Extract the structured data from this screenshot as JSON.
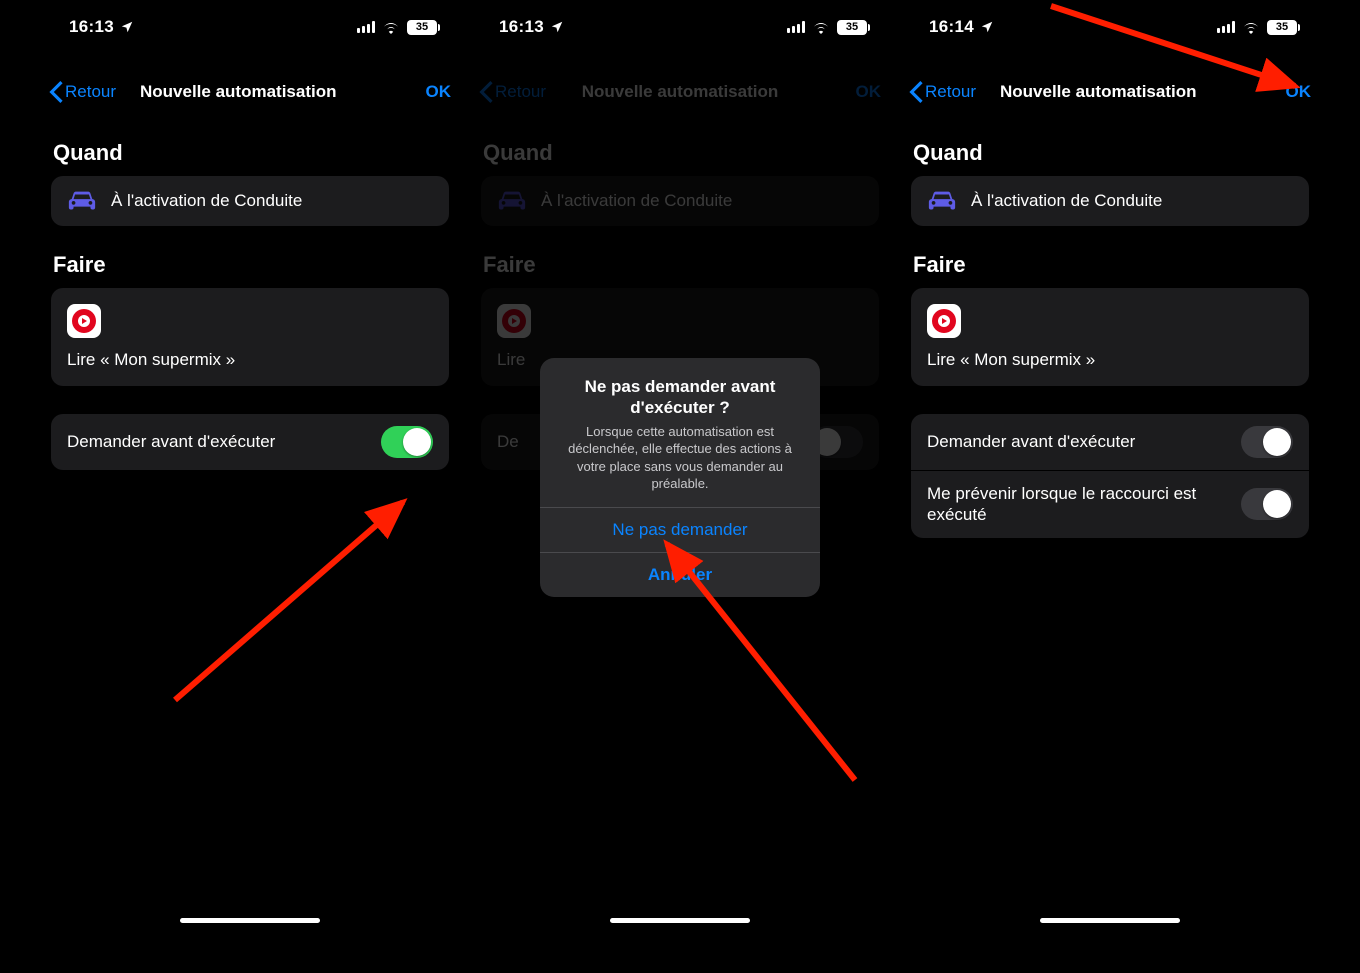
{
  "screens": {
    "s1": {
      "statusbar": {
        "time": "16:13",
        "battery": "35"
      },
      "nav": {
        "back": "Retour",
        "title": "Nouvelle automatisation",
        "done": "OK"
      },
      "sections": {
        "when_header": "Quand",
        "do_header": "Faire",
        "when_text": "À l'activation de Conduite",
        "action_text": "Lire « Mon supermix »"
      },
      "toggle1": {
        "label": "Demander avant d'exécuter",
        "on": true
      }
    },
    "s2": {
      "statusbar": {
        "time": "16:13",
        "battery": "35"
      },
      "nav": {
        "back": "Retour",
        "title": "Nouvelle automatisation",
        "done": "OK"
      },
      "sections": {
        "when_header": "Quand",
        "do_header": "Faire",
        "when_text": "À l'activation de Conduite",
        "action_text_cut": "Lire"
      },
      "toggle1": {
        "label_cut": "De"
      },
      "alert": {
        "title": "Ne pas demander avant d'exécuter ?",
        "message": "Lorsque cette automatisation est déclenchée, elle effectue des actions à votre place sans vous demander au préalable.",
        "confirm": "Ne pas demander",
        "cancel": "Annuler"
      }
    },
    "s3": {
      "statusbar": {
        "time": "16:14",
        "battery": "35"
      },
      "nav": {
        "back": "Retour",
        "title": "Nouvelle automatisation",
        "done": "OK"
      },
      "sections": {
        "when_header": "Quand",
        "do_header": "Faire",
        "when_text": "À l'activation de Conduite",
        "action_text": "Lire « Mon supermix »"
      },
      "toggle1": {
        "label": "Demander avant d'exécuter",
        "on": false
      },
      "toggle2": {
        "label": "Me prévenir lorsque le raccourci est exécuté",
        "on": false
      }
    }
  }
}
